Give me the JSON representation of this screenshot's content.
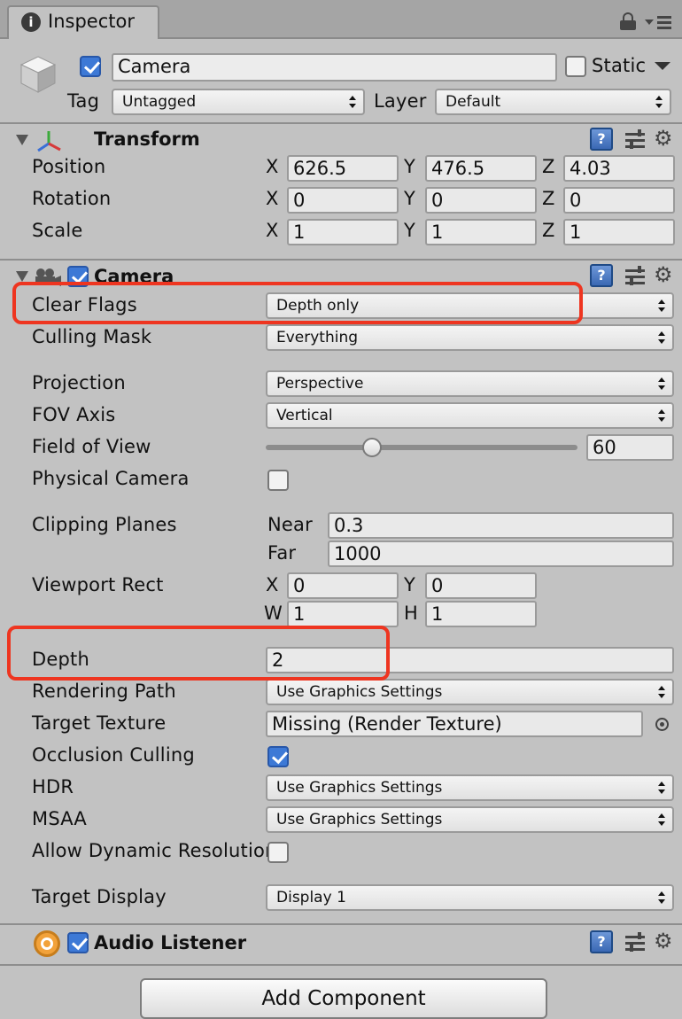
{
  "tab": {
    "title": "Inspector"
  },
  "object": {
    "name": "Camera",
    "static_label": "Static",
    "tag_label": "Tag",
    "tag_value": "Untagged",
    "layer_label": "Layer",
    "layer_value": "Default",
    "active": true,
    "static": false
  },
  "transform": {
    "title": "Transform",
    "rows": [
      {
        "label": "Position",
        "x": "626.5",
        "y": "476.5",
        "z": "4.03"
      },
      {
        "label": "Rotation",
        "x": "0",
        "y": "0",
        "z": "0"
      },
      {
        "label": "Scale",
        "x": "1",
        "y": "1",
        "z": "1"
      }
    ],
    "axes": {
      "x": "X",
      "y": "Y",
      "z": "Z"
    }
  },
  "camera": {
    "title": "Camera",
    "clear_flags": {
      "label": "Clear Flags",
      "value": "Depth only"
    },
    "culling_mask": {
      "label": "Culling Mask",
      "value": "Everything"
    },
    "projection": {
      "label": "Projection",
      "value": "Perspective"
    },
    "fov_axis": {
      "label": "FOV Axis",
      "value": "Vertical"
    },
    "field_of_view": {
      "label": "Field of View",
      "value": "60",
      "slider_fraction": 0.34
    },
    "physical_camera": {
      "label": "Physical Camera",
      "checked": false
    },
    "clipping_planes": {
      "label": "Clipping Planes",
      "near_label": "Near",
      "near": "0.3",
      "far_label": "Far",
      "far": "1000"
    },
    "viewport_rect": {
      "label": "Viewport Rect",
      "x_label": "X",
      "x": "0",
      "y_label": "Y",
      "y": "0",
      "w_label": "W",
      "w": "1",
      "h_label": "H",
      "h": "1"
    },
    "depth": {
      "label": "Depth",
      "value": "2"
    },
    "rendering_path": {
      "label": "Rendering Path",
      "value": "Use Graphics Settings"
    },
    "target_texture": {
      "label": "Target Texture",
      "value": "Missing (Render Texture)"
    },
    "occlusion_culling": {
      "label": "Occlusion Culling",
      "checked": true
    },
    "hdr": {
      "label": "HDR",
      "value": "Use Graphics Settings"
    },
    "msaa": {
      "label": "MSAA",
      "value": "Use Graphics Settings"
    },
    "allow_dynamic_resolution": {
      "label": "Allow Dynamic Resolution",
      "checked": false
    },
    "target_display": {
      "label": "Target Display",
      "value": "Display 1"
    }
  },
  "audio_listener": {
    "title": "Audio Listener"
  },
  "add_component": {
    "label": "Add Component"
  },
  "colors": {
    "highlight": "#ee3520",
    "check_blue": "#3d79d6",
    "panel_bg": "#c2c2c2"
  }
}
